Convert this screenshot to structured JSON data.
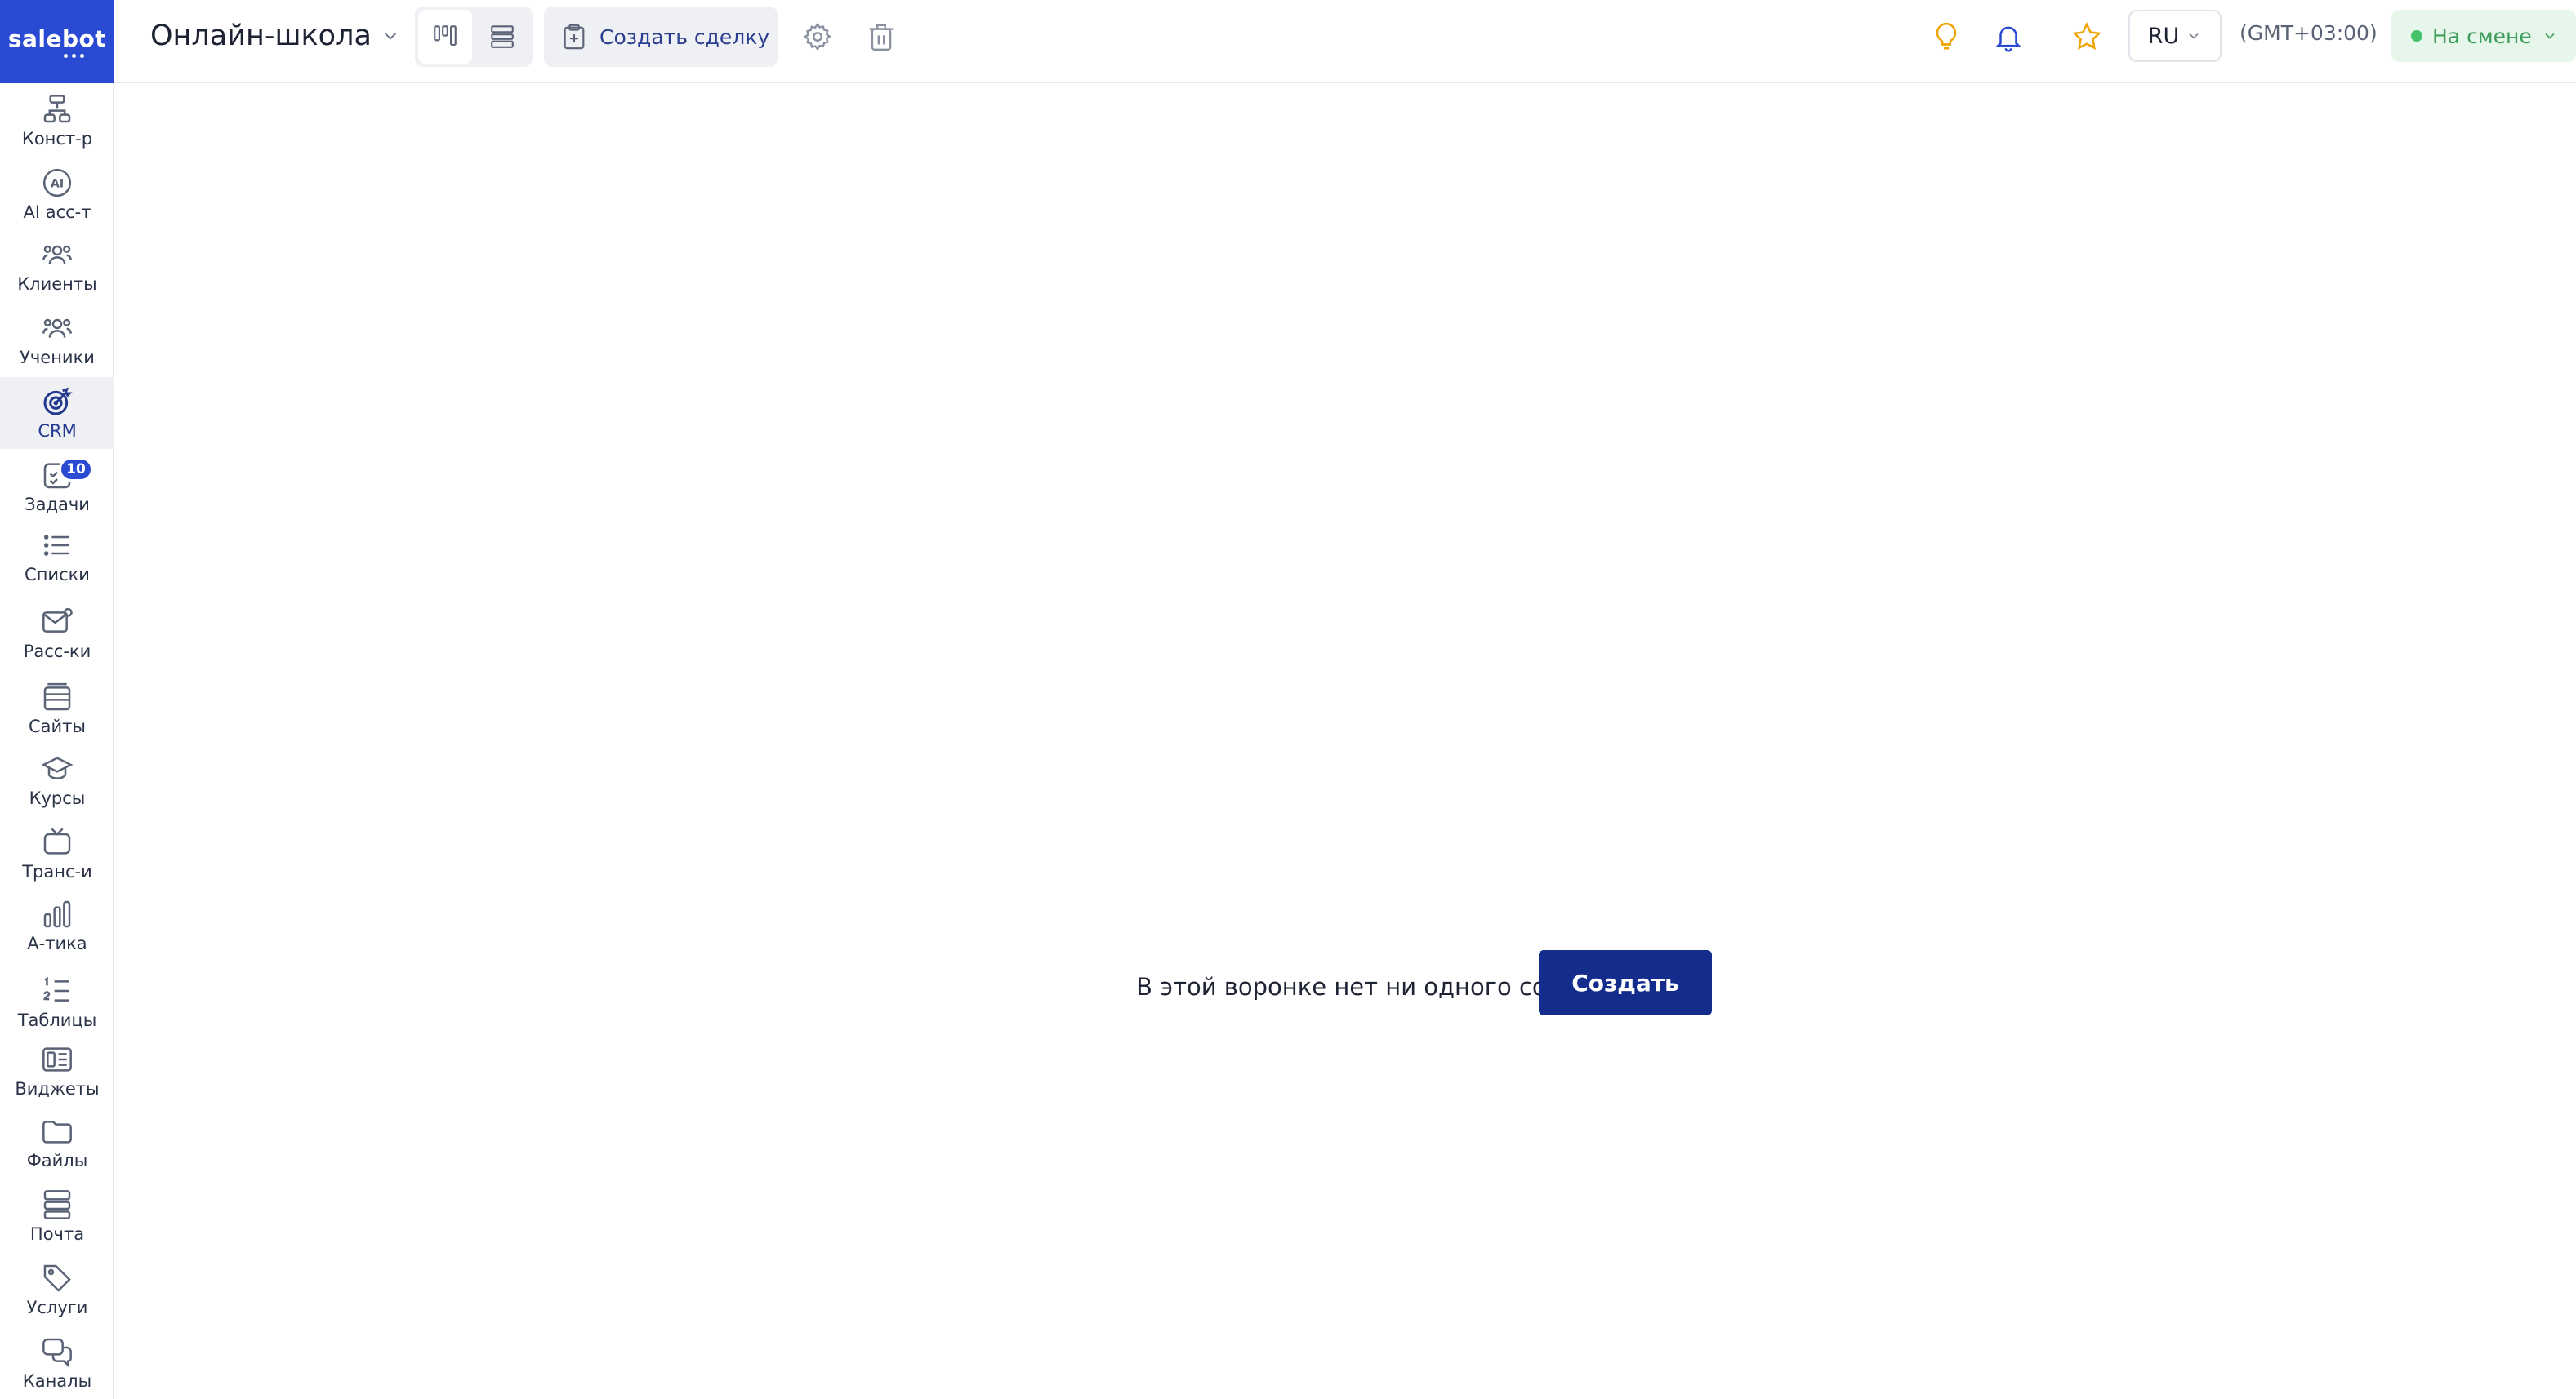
{
  "app": {
    "logo_text": "salebot"
  },
  "sidebar": {
    "items": [
      {
        "label": "Конст-р"
      },
      {
        "label": "AI асс-т"
      },
      {
        "label": "Клиенты"
      },
      {
        "label": "Ученики"
      },
      {
        "label": "CRM",
        "active": true
      },
      {
        "label": "Задачи",
        "badge": "10"
      },
      {
        "label": "Списки"
      },
      {
        "label": "Расс-ки"
      },
      {
        "label": "Сайты"
      },
      {
        "label": "Курсы"
      },
      {
        "label": "Транс-и"
      },
      {
        "label": "А-тика"
      },
      {
        "label": "Таблицы"
      },
      {
        "label": "Виджеты"
      },
      {
        "label": "Файлы"
      },
      {
        "label": "Почта"
      },
      {
        "label": "Услуги"
      },
      {
        "label": "Каналы"
      }
    ]
  },
  "header": {
    "funnel_title": "Онлайн-школа",
    "create_deal_label": "Создать сделку",
    "language": "RU",
    "timezone": "(GMT+03:00)",
    "shift_status": "На смене"
  },
  "main": {
    "empty_message": "В этой воронке нет ни одного состояния",
    "create_button": "Создать"
  },
  "colors": {
    "brand": "#2b4ad3",
    "primary_button": "#142d8c",
    "shift_bg": "#e6f6ea",
    "shift_text": "#3f9d5c",
    "bulb": "#f0a400",
    "star": "#f0a400"
  }
}
